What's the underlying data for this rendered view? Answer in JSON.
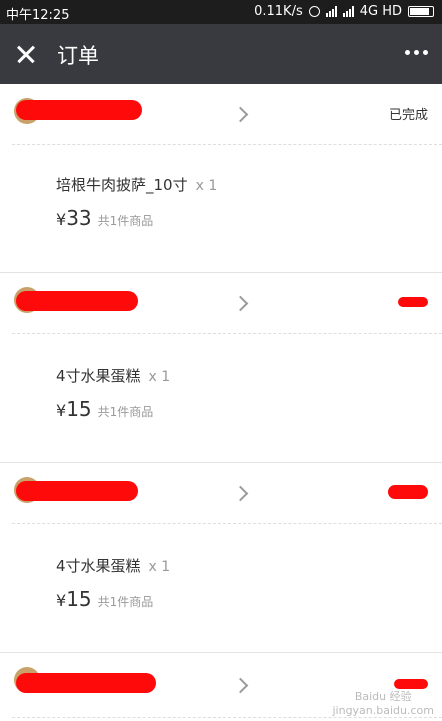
{
  "statusbar": {
    "time": "中午12:25",
    "network_speed": "0.11K/s",
    "network_type": "4G HD"
  },
  "header": {
    "title": "订单"
  },
  "orders": [
    {
      "status": "已完成",
      "item_name": "培根牛肉披萨_10寸",
      "quantity": "x 1",
      "currency": "¥",
      "price": "33",
      "count_text": "共1件商品"
    },
    {
      "status": "",
      "item_name": "4寸水果蛋糕",
      "quantity": "x 1",
      "currency": "¥",
      "price": "15",
      "count_text": "共1件商品"
    },
    {
      "status": "",
      "item_name": "4寸水果蛋糕",
      "quantity": "x 1",
      "currency": "¥",
      "price": "15",
      "count_text": "共1件商品"
    }
  ],
  "watermark": {
    "text": "Baidu 经验",
    "url": "jingyan.baidu.com"
  }
}
